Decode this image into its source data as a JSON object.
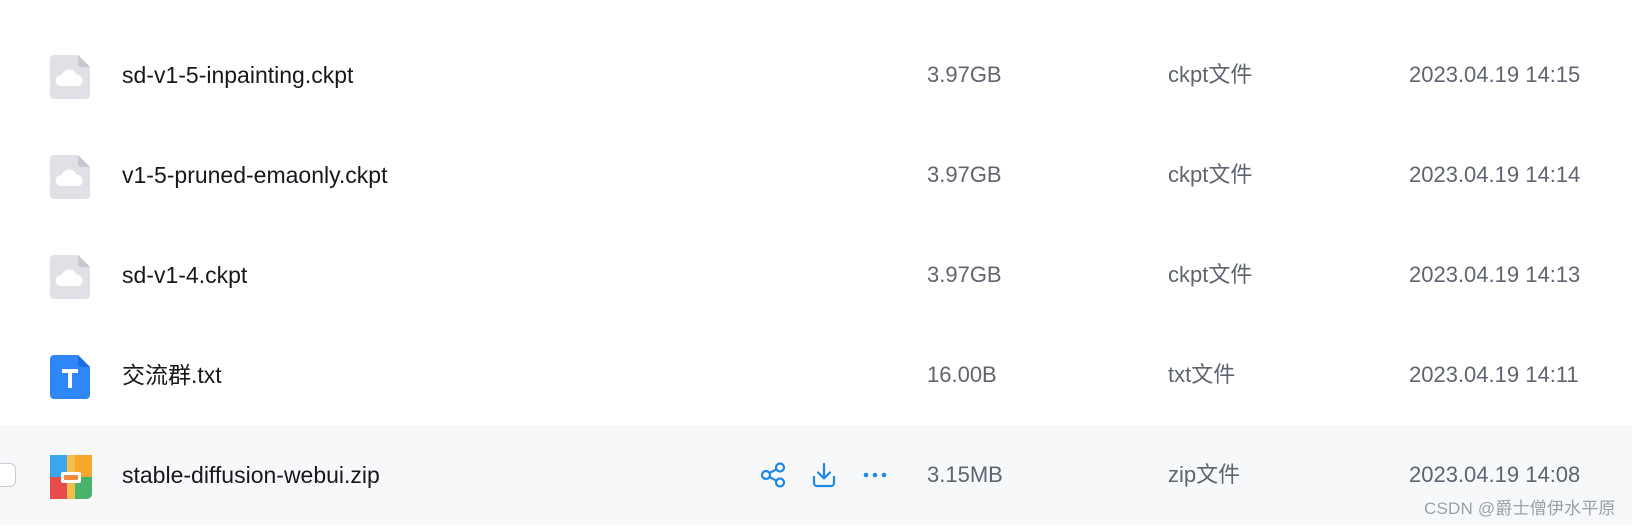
{
  "files": [
    {
      "name": "sd-v1-5-inpainting.ckpt",
      "size": "3.97GB",
      "type": "ckpt文件",
      "modified": "2023.04.19 14:15",
      "icon": "cloud-file-icon"
    },
    {
      "name": "v1-5-pruned-emaonly.ckpt",
      "size": "3.97GB",
      "type": "ckpt文件",
      "modified": "2023.04.19 14:14",
      "icon": "cloud-file-icon"
    },
    {
      "name": "sd-v1-4.ckpt",
      "size": "3.97GB",
      "type": "ckpt文件",
      "modified": "2023.04.19 14:13",
      "icon": "cloud-file-icon"
    },
    {
      "name": "交流群.txt",
      "size": "16.00B",
      "type": "txt文件",
      "modified": "2023.04.19 14:11",
      "icon": "text-file-icon"
    },
    {
      "name": "stable-diffusion-webui.zip",
      "size": "3.15MB",
      "type": "zip文件",
      "modified": "2023.04.19 14:08",
      "icon": "zip-archive-icon"
    }
  ],
  "hovered_row": {
    "actions": [
      "share-icon",
      "download-icon",
      "more-icon"
    ]
  },
  "watermark": "CSDN @爵士僧伊水平原",
  "colors": {
    "row_hover_bg": "#f7f8fa",
    "action_icon": "#1e88e5",
    "name_text": "#16181d",
    "meta_text": "#5f6470",
    "txt_icon": "#2f86f6"
  }
}
